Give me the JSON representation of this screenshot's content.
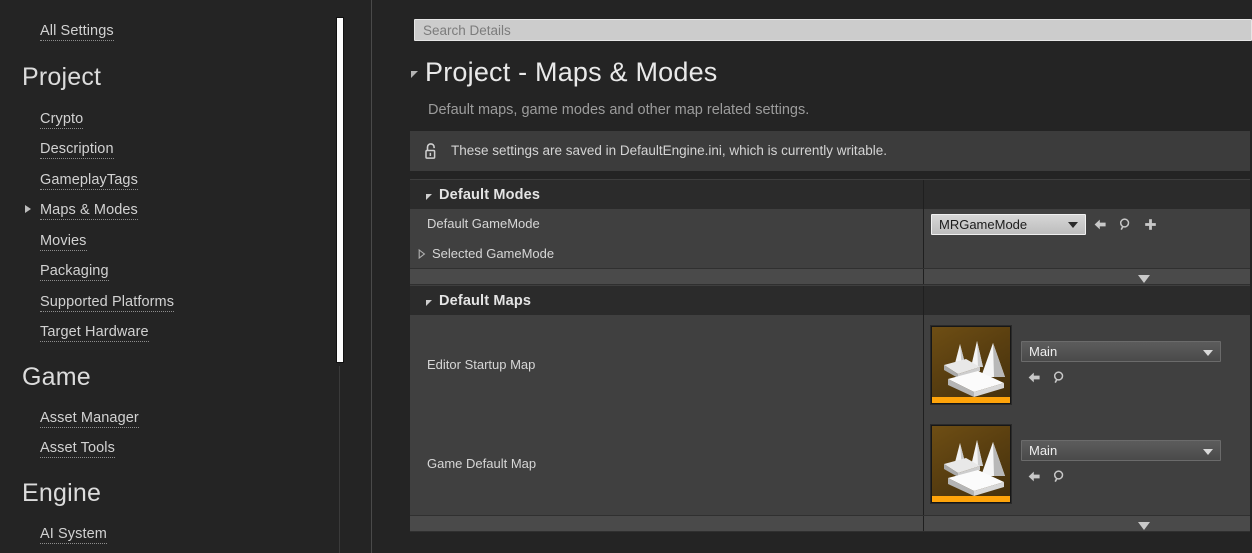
{
  "sidebar": {
    "top_link": {
      "label": "All Settings",
      "name": "all-settings"
    },
    "groups": [
      {
        "title": "Project",
        "items": [
          {
            "label": "Crypto",
            "expandable": false
          },
          {
            "label": "Description",
            "expandable": false
          },
          {
            "label": "GameplayTags",
            "expandable": false
          },
          {
            "label": "Maps & Modes",
            "expandable": true,
            "selected": true
          },
          {
            "label": "Movies",
            "expandable": false
          },
          {
            "label": "Packaging",
            "expandable": false
          },
          {
            "label": "Supported Platforms",
            "expandable": false
          },
          {
            "label": "Target Hardware",
            "expandable": false
          }
        ]
      },
      {
        "title": "Game",
        "items": [
          {
            "label": "Asset Manager",
            "expandable": false
          },
          {
            "label": "Asset Tools",
            "expandable": false
          }
        ]
      },
      {
        "title": "Engine",
        "items": [
          {
            "label": "AI System",
            "expandable": false
          }
        ]
      }
    ]
  },
  "details": {
    "search": {
      "placeholder": "Search Details",
      "value": ""
    },
    "page_title": "Project - Maps & Modes",
    "page_subtitle": "Default maps, game modes and other map related settings.",
    "info_bar": {
      "icon": "unlock-icon",
      "text": "These settings are saved in DefaultEngine.ini, which is currently writable."
    },
    "sections": [
      {
        "title": "Default Modes",
        "rows": [
          {
            "label": "Default GameMode",
            "control": "combo",
            "value": "MRGameMode",
            "icons": [
              "reset-arrow-icon",
              "browse-magnifier-icon",
              "plus-icon"
            ]
          },
          {
            "label": "Selected GameMode",
            "control": "expandable",
            "value": ""
          }
        ]
      },
      {
        "title": "Default Maps",
        "rows": [
          {
            "label": "Editor Startup Map",
            "control": "asset",
            "value": "Main",
            "icons": [
              "reset-arrow-icon",
              "browse-magnifier-icon"
            ]
          },
          {
            "label": "Game Default Map",
            "control": "asset",
            "value": "Main",
            "icons": [
              "reset-arrow-icon",
              "browse-magnifier-icon"
            ]
          }
        ]
      }
    ],
    "show_more_label": "show-more"
  },
  "colors": {
    "background": "#242424",
    "panel": "#404040",
    "section_header": "#2b2b2b",
    "accent_orange": "#ffa40a",
    "combo_light": "#cccccc"
  }
}
